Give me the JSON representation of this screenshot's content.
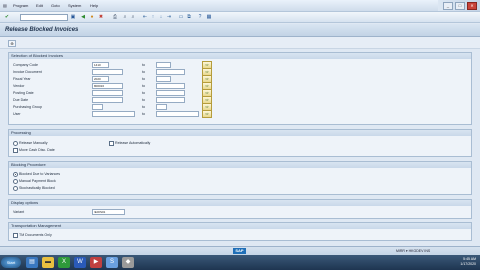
{
  "menu": {
    "items": [
      "Program",
      "Edit",
      "Goto",
      "System",
      "Help"
    ],
    "window_minimize": "_",
    "window_restore": "□",
    "window_close": "✕"
  },
  "toolbar": {
    "command_field_value": "",
    "icons": [
      "enter-icon",
      "save-icon",
      "back-icon",
      "exit-icon",
      "cancel-icon",
      "print-icon",
      "find-icon",
      "find-next-icon",
      "first-page-icon",
      "prev-page-icon",
      "next-page-icon",
      "last-page-icon",
      "new-session-icon",
      "shortcut-icon",
      "help-icon",
      "layout-icon"
    ]
  },
  "title": "Release Blocked Invoices",
  "selection": {
    "header": "Selection of Blocked Invoices",
    "to_label": "to",
    "rows": [
      {
        "label": "Company Code",
        "from": "1410",
        "to": ""
      },
      {
        "label": "Invoice Document",
        "from": "",
        "to": ""
      },
      {
        "label": "Fiscal Year",
        "from": "2020",
        "to": ""
      },
      {
        "label": "Vendor",
        "from": "800016",
        "to": ""
      },
      {
        "label": "Posting Date",
        "from": "",
        "to": ""
      },
      {
        "label": "Due Date",
        "from": "",
        "to": ""
      },
      {
        "label": "Purchasing Group",
        "from": "",
        "to": ""
      },
      {
        "label": "User",
        "from": "",
        "to": ""
      }
    ]
  },
  "processing": {
    "header": "Processing",
    "release_manually": "Release Manually",
    "release_automatically": "Release Automatically",
    "move_cash_disc": "Move Cash Disc. Date"
  },
  "blocking": {
    "header": "Blocking Procedure",
    "options": [
      "Blocked Due to Variances",
      "Manual Payment Block",
      "Stochastically Blocked"
    ],
    "selected_index": 0
  },
  "display": {
    "header": "Display options",
    "variant_label": "Variant",
    "variant_value": "/EOIS01"
  },
  "transport": {
    "header": "Transportation Management",
    "tm_only": "TM Documents Only"
  },
  "status": {
    "logo": "SAP",
    "system_info": "MIRR  ▾  HKGDEV  INS"
  },
  "taskbar": {
    "start": "Start",
    "time": "5:45 AM",
    "date": "1/17/2020"
  }
}
